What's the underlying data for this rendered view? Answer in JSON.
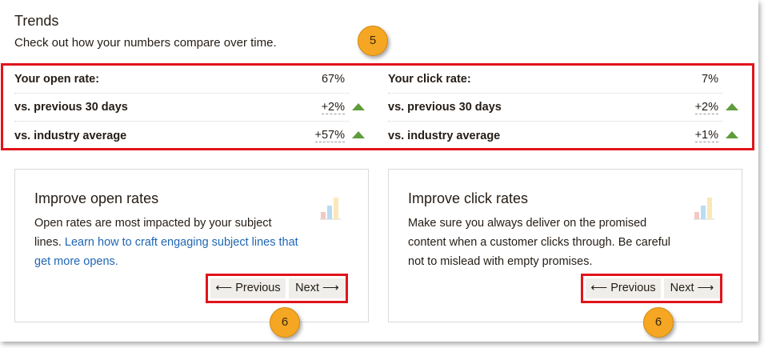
{
  "trends": {
    "title": "Trends",
    "subtitle": "Check out how your numbers compare over time."
  },
  "callouts": {
    "stats": "5",
    "pager_left": "6",
    "pager_right": "6"
  },
  "open_rate": {
    "label": "Your open rate:",
    "value": "67%",
    "prev_label": "vs. previous 30 days",
    "prev_value": "+2%",
    "prev_trend": "up",
    "industry_label": "vs. industry average",
    "industry_value": "+57%",
    "industry_trend": "up"
  },
  "click_rate": {
    "label": "Your click rate:",
    "value": "7%",
    "prev_label": "vs. previous 30 days",
    "prev_value": "+2%",
    "prev_trend": "up",
    "industry_label": "vs. industry average",
    "industry_value": "+1%",
    "industry_trend": "up"
  },
  "card_open": {
    "title": "Improve open rates",
    "body_text": "Open rates are most impacted by your subject lines. ",
    "link_text": "Learn how to craft engaging subject lines that get more opens.",
    "prev_label": "⟵ Previous",
    "next_label": "Next ⟶",
    "icon": "bar-chart-icon"
  },
  "card_click": {
    "title": "Improve click rates",
    "body_text": "Make sure you always deliver on the promised content when a customer clicks through. Be careful not to mislead with empty promises.",
    "prev_label": "⟵ Previous",
    "next_label": "Next ⟶",
    "icon": "bar-chart-icon"
  },
  "colors": {
    "trend_up": "#5f9c3b",
    "highlight": "#e1141c",
    "callout": "#f5a623",
    "link": "#1e66b4"
  }
}
